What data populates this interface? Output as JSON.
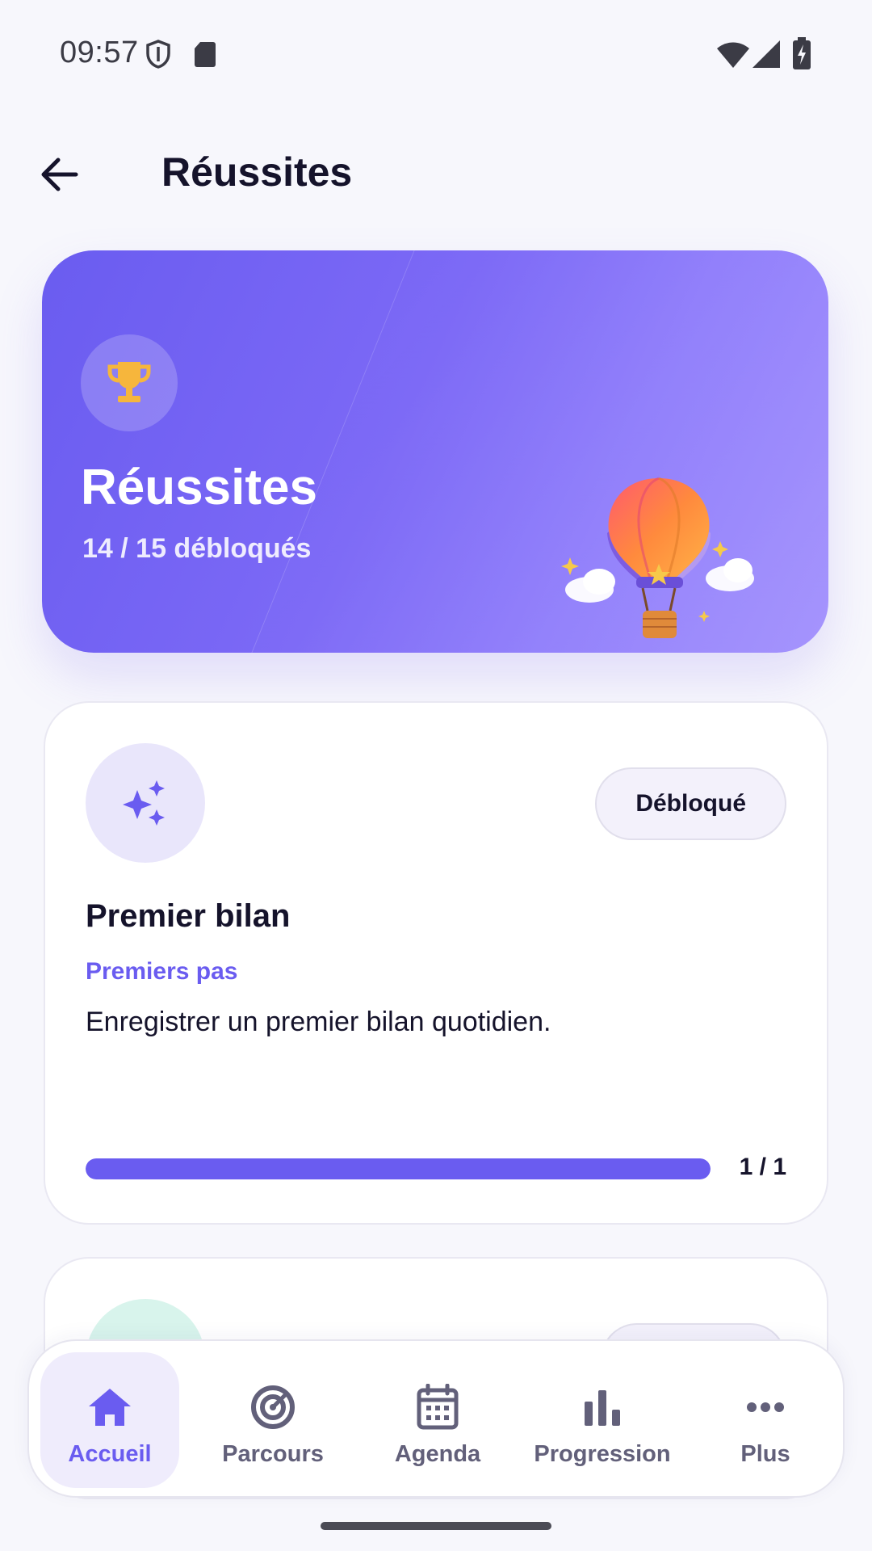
{
  "status_bar": {
    "time": "09:57",
    "icons": [
      "shield-icon",
      "sd-card-icon",
      "wifi-icon",
      "signal-icon",
      "battery-charging-icon"
    ]
  },
  "app_bar": {
    "title": "Réussites",
    "back_icon": "arrow-back-icon"
  },
  "hero": {
    "title": "Réussites",
    "subtitle": "14 / 15 débloqués",
    "icon": "trophy-icon",
    "illustration": "hot-air-balloon",
    "colors": {
      "gradient_start": "#6a5cf0",
      "gradient_end": "#a08efd",
      "trophy": "#f6b63c"
    }
  },
  "achievements": [
    {
      "icon": "sparkles-icon",
      "badge": "Débloqué",
      "title": "Premier bilan",
      "category": "Premiers pas",
      "description": "Enregistrer un premier bilan quotidien.",
      "progress": 1.0,
      "progress_label": "1 / 1"
    }
  ],
  "bottom_nav": {
    "items": [
      {
        "label": "Accueil",
        "icon": "home-icon",
        "active": true
      },
      {
        "label": "Parcours",
        "icon": "target-icon",
        "active": false
      },
      {
        "label": "Agenda",
        "icon": "calendar-icon",
        "active": false
      },
      {
        "label": "Progression",
        "icon": "bar-chart-icon",
        "active": false
      },
      {
        "label": "Plus",
        "icon": "more-icon",
        "active": false
      }
    ]
  },
  "colors": {
    "accent": "#6a5cf0",
    "background": "#f7f7fc",
    "text": "#15132b"
  }
}
